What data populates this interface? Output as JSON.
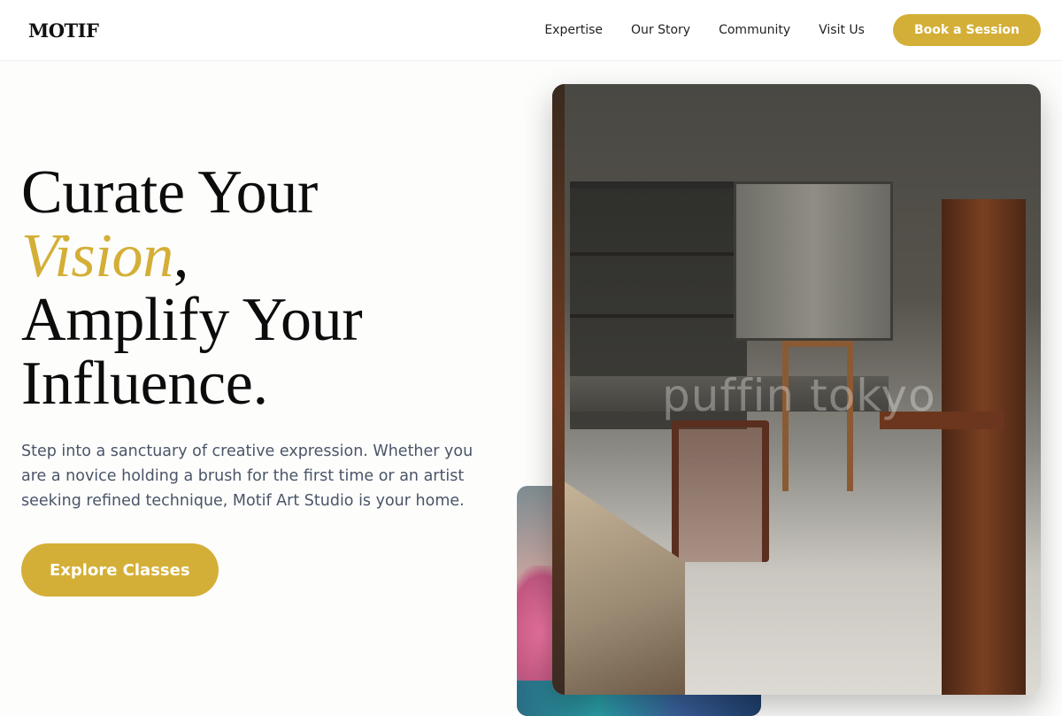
{
  "brand": {
    "logo": "MOTIF"
  },
  "nav": {
    "links": [
      "Expertise",
      "Our Story",
      "Community",
      "Visit Us"
    ],
    "cta_label": "Book a Session"
  },
  "hero": {
    "line1": "Curate Your",
    "line2_accent": "Vision",
    "line2_punct": ",",
    "line3": "Amplify Your",
    "line4": "Influence.",
    "subtext": "Step into a sanctuary of creative expression. Whether you are a novice holding a brush for the first time or an artist seeking refined technique, Motif Art Studio is your home.",
    "button_label": "Explore Classes"
  },
  "images": {
    "main_watermark": "puffin tokyo"
  },
  "colors": {
    "accent": "#d4af37",
    "heading": "#0c0c0c",
    "body_text": "#4a5568"
  }
}
